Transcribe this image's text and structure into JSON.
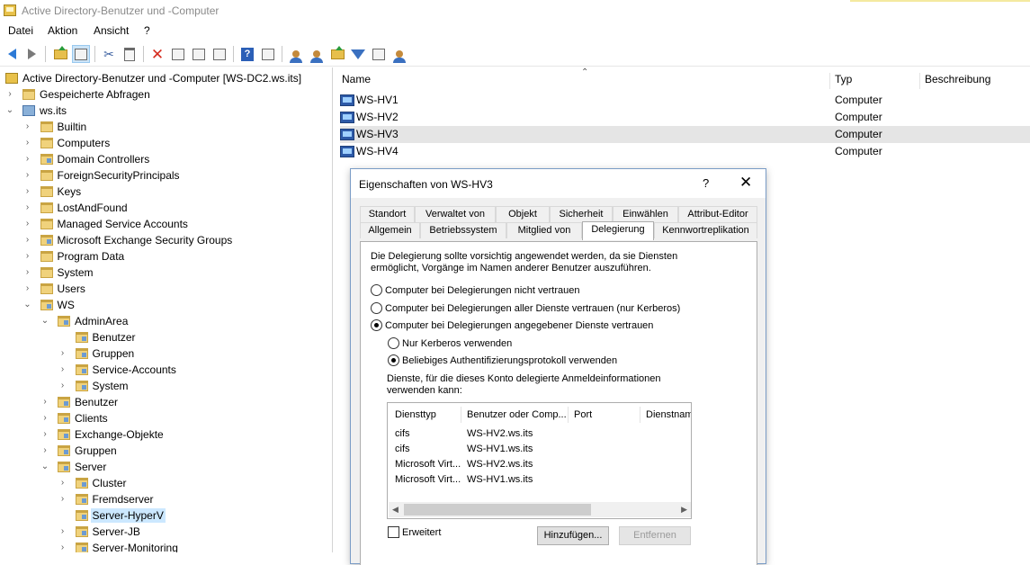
{
  "window": {
    "title": "Active Directory-Benutzer und -Computer"
  },
  "menu": [
    "Datei",
    "Aktion",
    "Ansicht",
    "?"
  ],
  "toolbar": {
    "icons": [
      "back-arrow-icon",
      "forward-arrow-icon",
      "folder-up-icon",
      "console-tree-icon",
      "cut-icon",
      "paste-icon",
      "delete-icon",
      "properties-icon",
      "refresh-icon",
      "export-icon",
      "help-icon",
      "console-icon",
      "new-user-icon",
      "new-group-icon",
      "new-ou-icon",
      "filter-icon",
      "find-icon",
      "add-to-group-icon"
    ]
  },
  "tree": [
    {
      "label": "Active Directory-Benutzer und -Computer [WS-DC2.ws.its]",
      "depth": 0,
      "icon": "root",
      "twisty": ""
    },
    {
      "label": "Gespeicherte Abfragen",
      "depth": 1,
      "icon": "folder",
      "twisty": "›"
    },
    {
      "label": "ws.its",
      "depth": 1,
      "icon": "domain",
      "twisty": "⌄"
    },
    {
      "label": "Builtin",
      "depth": 2,
      "icon": "folder",
      "twisty": "›"
    },
    {
      "label": "Computers",
      "depth": 2,
      "icon": "folder",
      "twisty": "›"
    },
    {
      "label": "Domain Controllers",
      "depth": 2,
      "icon": "ou",
      "twisty": "›"
    },
    {
      "label": "ForeignSecurityPrincipals",
      "depth": 2,
      "icon": "folder",
      "twisty": "›"
    },
    {
      "label": "Keys",
      "depth": 2,
      "icon": "folder",
      "twisty": "›"
    },
    {
      "label": "LostAndFound",
      "depth": 2,
      "icon": "folder",
      "twisty": "›"
    },
    {
      "label": "Managed Service Accounts",
      "depth": 2,
      "icon": "folder",
      "twisty": "›"
    },
    {
      "label": "Microsoft Exchange Security Groups",
      "depth": 2,
      "icon": "ou",
      "twisty": "›"
    },
    {
      "label": "Program Data",
      "depth": 2,
      "icon": "folder",
      "twisty": "›"
    },
    {
      "label": "System",
      "depth": 2,
      "icon": "folder",
      "twisty": "›"
    },
    {
      "label": "Users",
      "depth": 2,
      "icon": "folder",
      "twisty": "›"
    },
    {
      "label": "WS",
      "depth": 2,
      "icon": "ou",
      "twisty": "⌄"
    },
    {
      "label": "AdminArea",
      "depth": 3,
      "icon": "ou",
      "twisty": "⌄"
    },
    {
      "label": "Benutzer",
      "depth": 4,
      "icon": "ou",
      "twisty": ""
    },
    {
      "label": "Gruppen",
      "depth": 4,
      "icon": "ou",
      "twisty": "›"
    },
    {
      "label": "Service-Accounts",
      "depth": 4,
      "icon": "ou",
      "twisty": "›"
    },
    {
      "label": "System",
      "depth": 4,
      "icon": "ou",
      "twisty": "›"
    },
    {
      "label": "Benutzer",
      "depth": 3,
      "icon": "ou",
      "twisty": "›"
    },
    {
      "label": "Clients",
      "depth": 3,
      "icon": "ou",
      "twisty": "›"
    },
    {
      "label": "Exchange-Objekte",
      "depth": 3,
      "icon": "ou",
      "twisty": "›"
    },
    {
      "label": "Gruppen",
      "depth": 3,
      "icon": "ou",
      "twisty": "›"
    },
    {
      "label": "Server",
      "depth": 3,
      "icon": "ou",
      "twisty": "⌄"
    },
    {
      "label": "Cluster",
      "depth": 4,
      "icon": "ou",
      "twisty": "›"
    },
    {
      "label": "Fremdserver",
      "depth": 4,
      "icon": "ou",
      "twisty": "›"
    },
    {
      "label": "Server-HyperV",
      "depth": 4,
      "icon": "ou",
      "twisty": "",
      "selected": true
    },
    {
      "label": "Server-JB",
      "depth": 4,
      "icon": "ou",
      "twisty": "›"
    },
    {
      "label": "Server-Monitoring",
      "depth": 4,
      "icon": "ou",
      "twisty": "›"
    }
  ],
  "list": {
    "columns": {
      "name": "Name",
      "type": "Typ",
      "desc": "Beschreibung"
    },
    "rows": [
      {
        "name": "WS-HV1",
        "type": "Computer"
      },
      {
        "name": "WS-HV2",
        "type": "Computer"
      },
      {
        "name": "WS-HV3",
        "type": "Computer",
        "selected": true
      },
      {
        "name": "WS-HV4",
        "type": "Computer"
      }
    ]
  },
  "dialog": {
    "title": "Eigenschaften von WS-HV3",
    "help": "?",
    "close": "✕",
    "tabs_row1": [
      "Standort",
      "Verwaltet von",
      "Objekt",
      "Sicherheit",
      "Einwählen",
      "Attribut-Editor"
    ],
    "tabs_row2": [
      "Allgemein",
      "Betriebssystem",
      "Mitglied von",
      "Delegierung",
      "Kennwortreplikation"
    ],
    "active_tab": "Delegierung",
    "intro_line1": "Die Delegierung sollte vorsichtig angewendet werden, da sie Diensten",
    "intro_line2": "ermöglicht, Vorgänge im Namen anderer Benutzer auszuführen.",
    "radio1": "Computer bei Delegierungen nicht vertrauen",
    "radio2": "Computer bei Delegierungen aller Dienste vertrauen (nur Kerberos)",
    "radio3": "Computer bei Delegierungen angegebener Dienste vertrauen",
    "sub_radio1": "Nur Kerberos verwenden",
    "sub_radio2": "Beliebiges Authentifizierungsprotokoll verwenden",
    "services_label1": "Dienste, für die dieses Konto delegierte Anmeldeinformationen",
    "services_label2": "verwenden kann:",
    "service_columns": [
      "Diensttyp",
      "Benutzer oder Comp...",
      "Port",
      "Dienstnam"
    ],
    "services": [
      {
        "type": "cifs",
        "host": "WS-HV2.ws.its"
      },
      {
        "type": "cifs",
        "host": "WS-HV1.ws.its"
      },
      {
        "type": "Microsoft Virt...",
        "host": "WS-HV2.ws.its"
      },
      {
        "type": "Microsoft Virt...",
        "host": "WS-HV1.ws.its"
      }
    ],
    "expanded_label": "Erweitert",
    "add_button": "Hinzufügen...",
    "remove_button": "Entfernen"
  }
}
